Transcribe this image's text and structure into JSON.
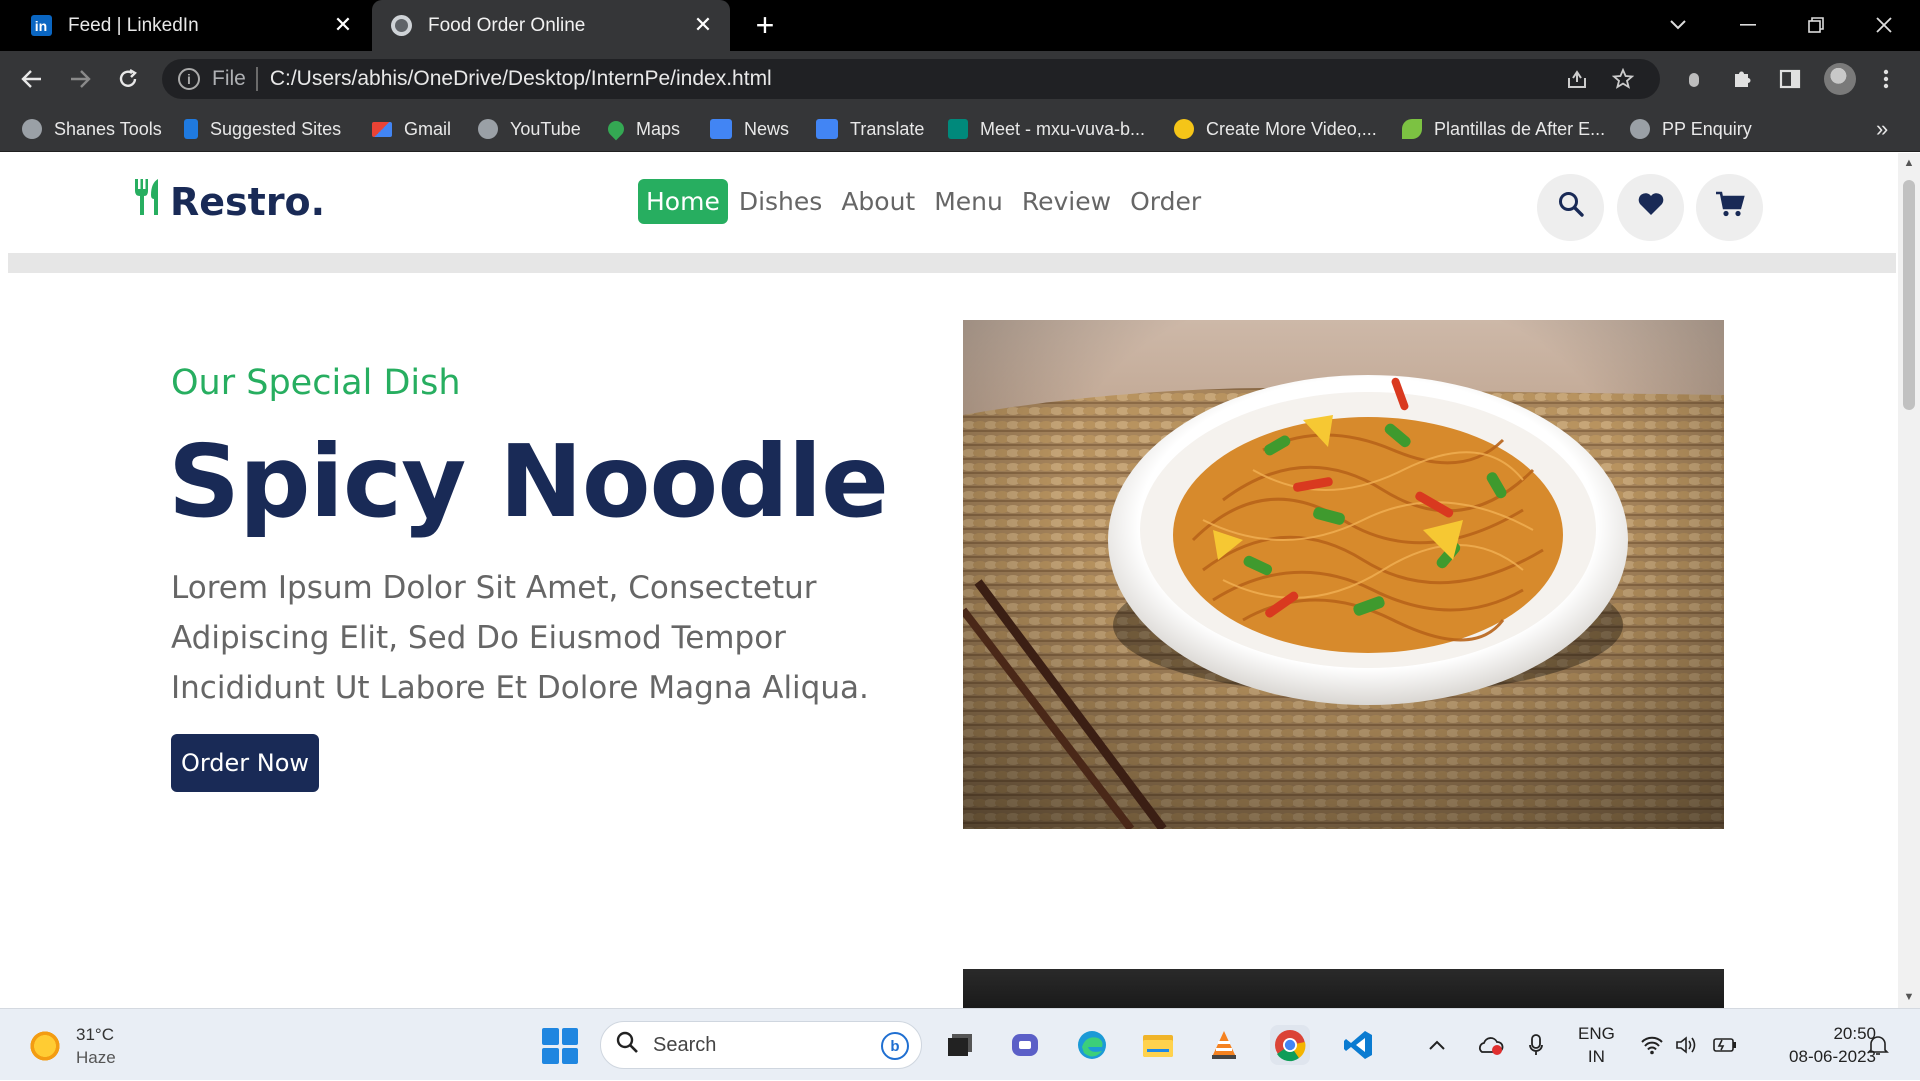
{
  "browser": {
    "tabs": [
      {
        "title": "Feed | LinkedIn",
        "icon": "linkedin-icon",
        "active": false
      },
      {
        "title": "Food Order Online",
        "icon": "globe-icon",
        "active": true
      }
    ],
    "close_glyph": "✕",
    "new_tab_glyph": "+",
    "address": {
      "scheme_label": "File",
      "url": "C:/Users/abhis/OneDrive/Desktop/InternPe/index.html"
    },
    "bookmarks": [
      {
        "label": "Shanes Tools",
        "icon": "globe-icon"
      },
      {
        "label": "Suggested Sites",
        "icon": "bing-icon"
      },
      {
        "label": "Gmail",
        "icon": "gmail-icon"
      },
      {
        "label": "YouTube",
        "icon": "globe-icon"
      },
      {
        "label": "Maps",
        "icon": "maps-icon"
      },
      {
        "label": "News",
        "icon": "news-icon"
      },
      {
        "label": "Translate",
        "icon": "translate-icon"
      },
      {
        "label": "Meet - mxu-vuva-b...",
        "icon": "meet-icon"
      },
      {
        "label": "Create More Video,...",
        "icon": "dollar-icon"
      },
      {
        "label": "Plantillas de After E...",
        "icon": "leaf-icon"
      },
      {
        "label": "PP Enquiry",
        "icon": "globe-icon"
      }
    ],
    "bookmarks_overflow": "»"
  },
  "site": {
    "logo_text": "Restro",
    "logo_dot": ".",
    "nav": [
      "Home",
      "Dishes",
      "About",
      "Menu",
      "Review",
      "Order"
    ],
    "active_nav": "Home",
    "hero": {
      "eyebrow": "Our Special Dish",
      "title": "Spicy Noodle",
      "description": "Lorem Ipsum Dolor Sit Amet, Consectetur Adipiscing Elit, Sed Do Eiusmod Tempor Incididunt Ut Labore Et Dolore Magna Aliqua.",
      "cta": "Order Now"
    },
    "colors": {
      "primary": "#192a56",
      "accent": "#27ae60",
      "muted": "#666666"
    }
  },
  "taskbar": {
    "weather": {
      "temp": "31°C",
      "condition": "Haze"
    },
    "search_placeholder": "Search",
    "lang": {
      "line1": "ENG",
      "line2": "IN"
    },
    "clock": {
      "time": "20:50",
      "date": "08-06-2023"
    }
  }
}
